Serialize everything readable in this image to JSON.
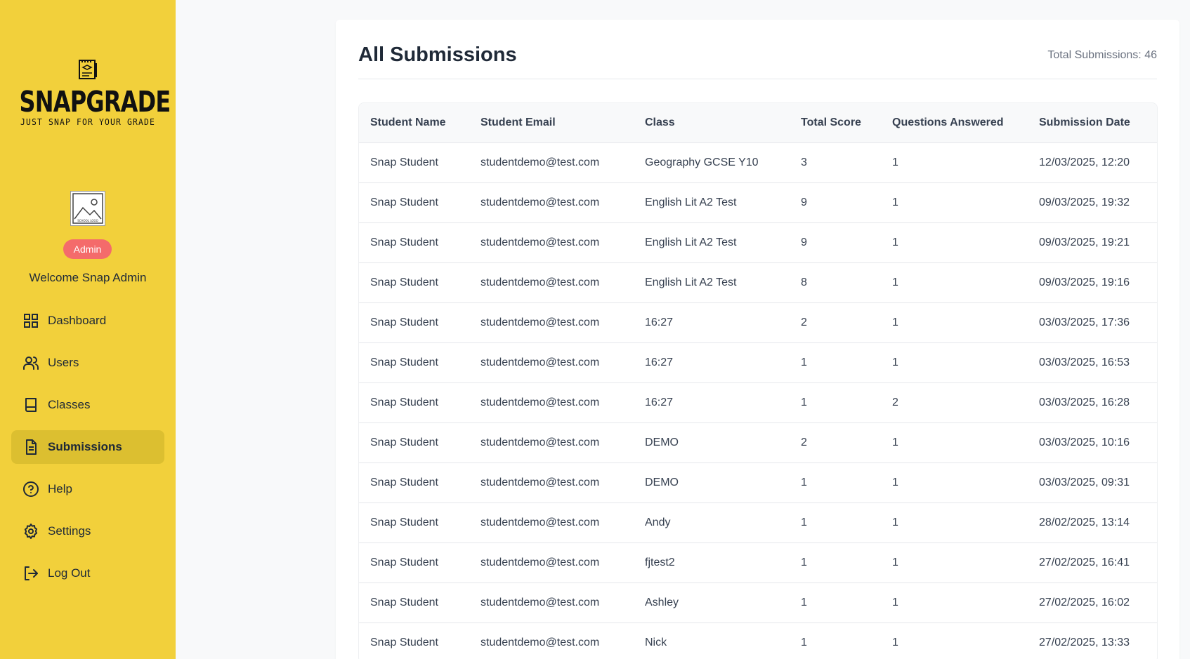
{
  "brand": {
    "name": "SNAPGRADE",
    "tagline": "JUST SNAP FOR YOUR GRADE"
  },
  "school_logo": {
    "text": "SCHOOL LOGO"
  },
  "user": {
    "role": "Admin",
    "welcome": "Welcome Snap Admin"
  },
  "nav": [
    {
      "label": "Dashboard",
      "icon": "dashboard-grid-icon",
      "active": false
    },
    {
      "label": "Users",
      "icon": "users-icon",
      "active": false
    },
    {
      "label": "Classes",
      "icon": "book-icon",
      "active": false
    },
    {
      "label": "Submissions",
      "icon": "document-icon",
      "active": true
    },
    {
      "label": "Help",
      "icon": "help-circle-icon",
      "active": false
    },
    {
      "label": "Settings",
      "icon": "gear-icon",
      "active": false
    },
    {
      "label": "Log Out",
      "icon": "logout-icon",
      "active": false
    }
  ],
  "main": {
    "title": "All Submissions",
    "total": "Total Submissions: 46"
  },
  "table": {
    "columns": [
      "Student Name",
      "Student Email",
      "Class",
      "Total Score",
      "Questions Answered",
      "Submission Date"
    ],
    "rows": [
      [
        "Snap Student",
        "studentdemo@test.com",
        "Geography GCSE Y10",
        "3",
        "1",
        "12/03/2025, 12:20"
      ],
      [
        "Snap Student",
        "studentdemo@test.com",
        "English Lit A2 Test",
        "9",
        "1",
        "09/03/2025, 19:32"
      ],
      [
        "Snap Student",
        "studentdemo@test.com",
        "English Lit A2 Test",
        "9",
        "1",
        "09/03/2025, 19:21"
      ],
      [
        "Snap Student",
        "studentdemo@test.com",
        "English Lit A2 Test",
        "8",
        "1",
        "09/03/2025, 19:16"
      ],
      [
        "Snap Student",
        "studentdemo@test.com",
        "16:27",
        "2",
        "1",
        "03/03/2025, 17:36"
      ],
      [
        "Snap Student",
        "studentdemo@test.com",
        "16:27",
        "1",
        "1",
        "03/03/2025, 16:53"
      ],
      [
        "Snap Student",
        "studentdemo@test.com",
        "16:27",
        "1",
        "2",
        "03/03/2025, 16:28"
      ],
      [
        "Snap Student",
        "studentdemo@test.com",
        "DEMO",
        "2",
        "1",
        "03/03/2025, 10:16"
      ],
      [
        "Snap Student",
        "studentdemo@test.com",
        "DEMO",
        "1",
        "1",
        "03/03/2025, 09:31"
      ],
      [
        "Snap Student",
        "studentdemo@test.com",
        "Andy",
        "1",
        "1",
        "28/02/2025, 13:14"
      ],
      [
        "Snap Student",
        "studentdemo@test.com",
        "fjtest2",
        "1",
        "1",
        "27/02/2025, 16:41"
      ],
      [
        "Snap Student",
        "studentdemo@test.com",
        "Ashley",
        "1",
        "1",
        "27/02/2025, 16:02"
      ],
      [
        "Snap Student",
        "studentdemo@test.com",
        "Nick",
        "1",
        "1",
        "27/02/2025, 13:33"
      ]
    ]
  },
  "colors": {
    "sidebar": "#f2d03b",
    "active_nav": "#dcbf30",
    "badge": "#f46b6b"
  }
}
